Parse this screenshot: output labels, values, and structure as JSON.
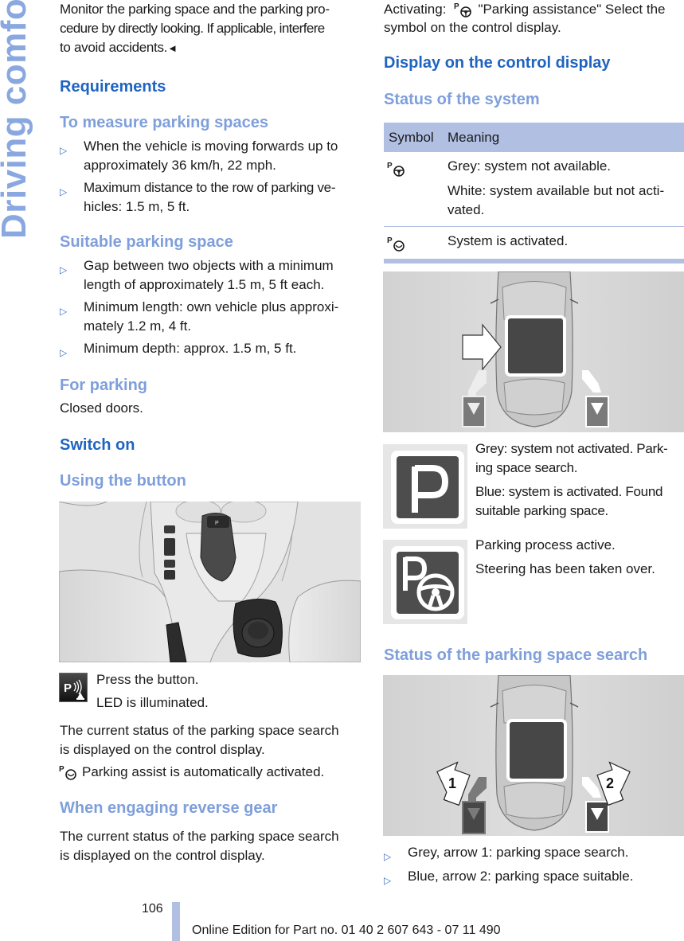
{
  "side_tab": "Driving comfort",
  "left": {
    "intro": "Monitor the parking space and the parking pro-cedure by directly looking. If applicable, interfere to avoid accidents.",
    "intro_lines": [
      "Monitor the parking space and the parking pro-",
      "cedure by directly looking. If applicable, interfere",
      "to avoid accidents."
    ],
    "end_mark": "◄",
    "requirements_heading": "Requirements",
    "measure_heading": "To measure parking spaces",
    "measure_items": [
      [
        "When the vehicle is moving forwards up to",
        "approximately 36 km/h, 22 mph."
      ],
      [
        "Maximum distance to the row of parking ve-",
        "hicles: 1.5 m, 5 ft."
      ]
    ],
    "suitable_heading": "Suitable parking space",
    "suitable_items": [
      [
        "Gap between two objects with a minimum",
        "length of approximately 1.5 m, 5 ft each."
      ],
      [
        "Minimum length: own vehicle plus approxi-",
        "mately 1.2 m, 4 ft."
      ],
      [
        "Minimum depth: approx. 1.5 m, 5 ft."
      ]
    ],
    "for_parking_heading": "For parking",
    "for_parking_text": "Closed doors.",
    "switch_on_heading": "Switch on",
    "using_button_heading": "Using the button",
    "press_button": "Press the button.",
    "led_text": "LED is illuminated.",
    "status_lines_1": [
      "The current status of the parking space search",
      "is displayed on the control display."
    ],
    "auto_activated": "Parking assist is automatically activated.",
    "reverse_heading": "When engaging reverse gear",
    "status_lines_2": [
      "The current status of the parking space search",
      "is displayed on the control display."
    ]
  },
  "right": {
    "activating_prefix": "Activating:",
    "activating_rest": "\"Parking assistance\" Select the",
    "activating_line2": "symbol on the control display.",
    "display_heading": "Display on the control display",
    "status_system_heading": "Status of the system",
    "table": {
      "headers": [
        "Symbol",
        "Meaning"
      ],
      "rows": [
        {
          "icon": "parking-assist-icon",
          "lines": [
            "Grey: system not available.",
            "White: system available but not acti-",
            "vated."
          ]
        },
        {
          "icon": "parking-assist-active-icon",
          "lines": [
            "System is activated."
          ]
        }
      ]
    },
    "p_icon_text": [
      "Grey: system not activated. Park-",
      "ing space search.",
      "Blue: system is activated. Found",
      "suitable parking space."
    ],
    "p_steer_text": [
      "Parking process active.",
      "Steering has been taken over."
    ],
    "search_heading": "Status of the parking space search",
    "arrow_labels": [
      "1",
      "2"
    ],
    "search_items": [
      "Grey, arrow 1: parking space search.",
      "Blue, arrow 2: parking space suitable."
    ]
  },
  "footer": {
    "page_number": "106",
    "edition": "Online Edition for Part no. 01 40 2 607 643 - 07 11 490"
  },
  "colors": {
    "heading_blue": "#1f64c0",
    "subheading_blue": "#7f9fdb",
    "table_band": "#b1bfe3",
    "side_tab": "#8aa8e0"
  }
}
